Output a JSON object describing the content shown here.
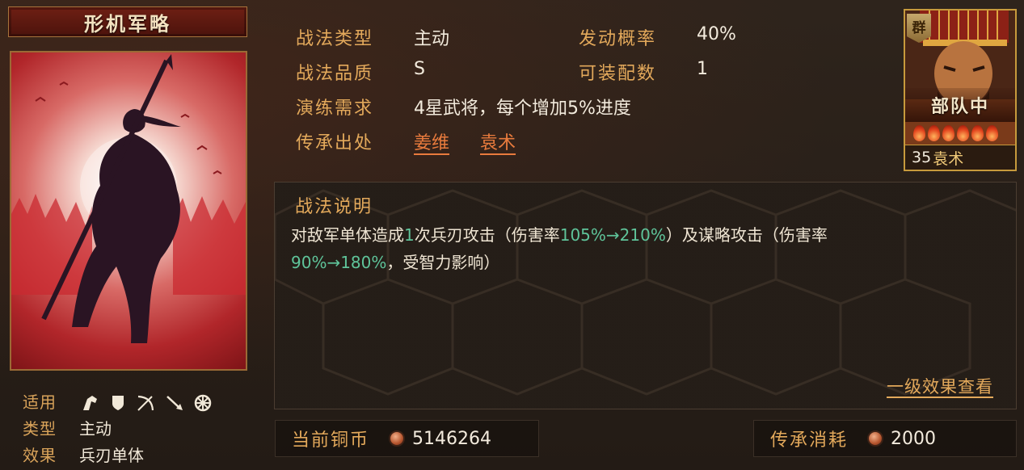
{
  "skill_card": {
    "title": "形机军略",
    "card_art": "silhouette-horseman-spear-red"
  },
  "info": {
    "applies_label": "适用",
    "applies_icons": [
      "cavalry-icon",
      "shield-icon",
      "bow-icon",
      "spear-icon",
      "siege-wheel-icon"
    ],
    "type_label": "类型",
    "type_value": "主动",
    "effect_label": "效果",
    "effect_value": "兵刃单体"
  },
  "stats": {
    "tactic_type_label": "战法类型",
    "tactic_type_value": "主动",
    "trigger_rate_label": "发动概率",
    "trigger_rate_value": "40%",
    "quality_label": "战法品质",
    "quality_value": "S",
    "equip_count_label": "可装配数",
    "equip_count_value": "1",
    "training_label": "演练需求",
    "training_value": "4星武将，每个增加5%进度",
    "inherit_label": "传承出处",
    "inherit_sources": [
      "姜维",
      "袁术"
    ]
  },
  "general": {
    "faction": "群",
    "troop_position": "部队中",
    "level": "35",
    "name": "袁术",
    "stars": 6
  },
  "description": {
    "title": "战法说明",
    "line1_a": "对敌军单体造成",
    "line1_hl1": "1",
    "line1_b": "次兵刃攻击（伤害率",
    "line1_hl2": "105%→210%",
    "line1_c": "）及谋略攻击（伤害率",
    "line2_hl": "90%→180%",
    "line2_b": "，受智力影响）",
    "effect_link": "一级效果查看"
  },
  "currency": {
    "current_copper_label": "当前铜币",
    "current_copper_value": "5146264",
    "inherit_cost_label": "传承消耗",
    "inherit_cost_value": "2000"
  },
  "colors": {
    "label_gold": "#e3a95b",
    "link_orange": "#e97b3d",
    "highlight_green": "#5fc49a",
    "title_red": "#6e1f14",
    "frame_gold": "#c79a3c"
  }
}
